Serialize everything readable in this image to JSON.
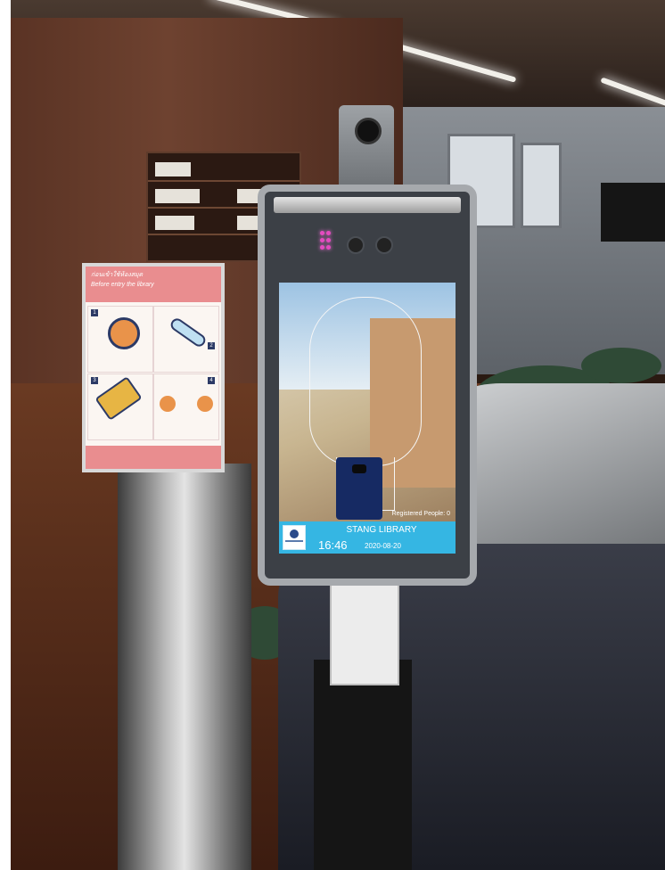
{
  "scene": {
    "description_colors": {
      "accent": "#35b6e3",
      "poster_pink": "#e98d8f"
    }
  },
  "poster": {
    "title_th": "ก่อนเข้าใช้ห้องสมุด",
    "title_en": "Before entry the library",
    "steps": [
      {
        "number": "1",
        "icon": "face-mask-icon",
        "caption": ""
      },
      {
        "number": "2",
        "icon": "thermometer-icon",
        "caption": ""
      },
      {
        "number": "3",
        "icon": "id-card-tap-icon",
        "caption": ""
      },
      {
        "number": "4",
        "icon": "social-distance-icon",
        "caption": ""
      }
    ],
    "footer": ""
  },
  "kiosk": {
    "registered": "Registered People: 0",
    "title": "STANG LIBRARY",
    "time": "16:46",
    "date": "2020-08-20"
  }
}
